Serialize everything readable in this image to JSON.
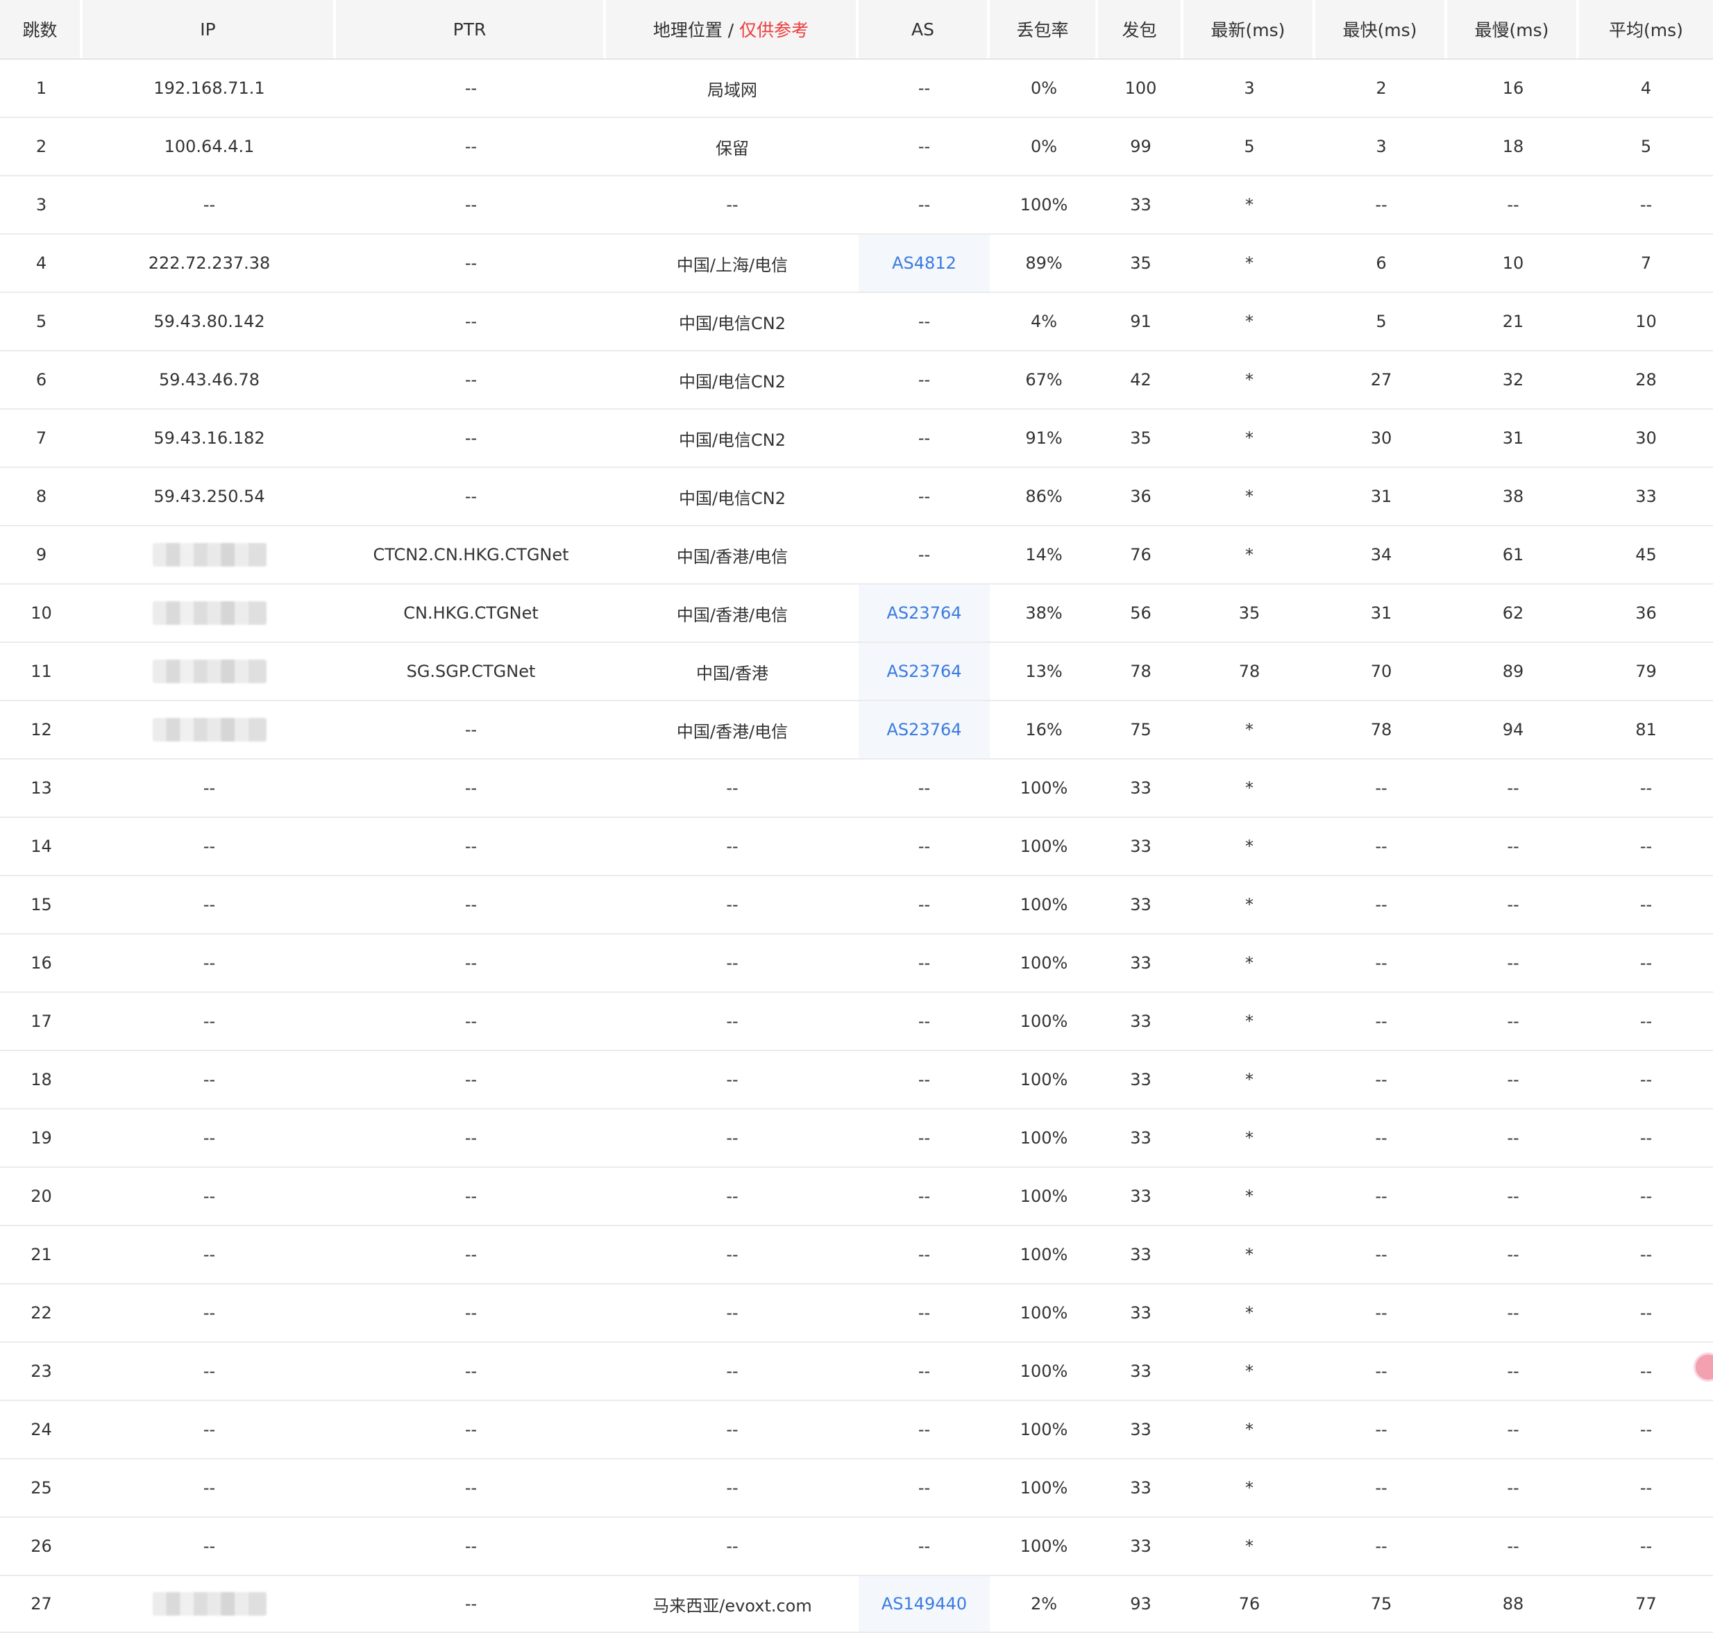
{
  "header": {
    "hop": "跳数",
    "ip": "IP",
    "ptr": "PTR",
    "geo": "地理位置 / ",
    "geo_ref": "仅供参考",
    "as": "AS",
    "loss": "丢包率",
    "sent": "发包",
    "last": "最新(ms)",
    "best": "最快(ms)",
    "worst": "最慢(ms)",
    "avg": "平均(ms)"
  },
  "rows": [
    {
      "hop": "1",
      "ip": "192.168.71.1",
      "ip_masked": false,
      "ptr": "--",
      "geo": "局域网",
      "as": "--",
      "loss": "0%",
      "sent": "100",
      "last": "3",
      "best": "2",
      "worst": "16",
      "avg": "4"
    },
    {
      "hop": "2",
      "ip": "100.64.4.1",
      "ip_masked": false,
      "ptr": "--",
      "geo": "保留",
      "as": "--",
      "loss": "0%",
      "sent": "99",
      "last": "5",
      "best": "3",
      "worst": "18",
      "avg": "5"
    },
    {
      "hop": "3",
      "ip": "--",
      "ip_masked": false,
      "ptr": "--",
      "geo": "--",
      "as": "--",
      "loss": "100%",
      "sent": "33",
      "last": "*",
      "best": "--",
      "worst": "--",
      "avg": "--"
    },
    {
      "hop": "4",
      "ip": "222.72.237.38",
      "ip_masked": false,
      "ptr": "--",
      "geo": "中国/上海/电信",
      "as": "AS4812",
      "loss": "89%",
      "sent": "35",
      "last": "*",
      "best": "6",
      "worst": "10",
      "avg": "7"
    },
    {
      "hop": "5",
      "ip": "59.43.80.142",
      "ip_masked": false,
      "ptr": "--",
      "geo": "中国/电信CN2",
      "as": "--",
      "loss": "4%",
      "sent": "91",
      "last": "*",
      "best": "5",
      "worst": "21",
      "avg": "10"
    },
    {
      "hop": "6",
      "ip": "59.43.46.78",
      "ip_masked": false,
      "ptr": "--",
      "geo": "中国/电信CN2",
      "as": "--",
      "loss": "67%",
      "sent": "42",
      "last": "*",
      "best": "27",
      "worst": "32",
      "avg": "28"
    },
    {
      "hop": "7",
      "ip": "59.43.16.182",
      "ip_masked": false,
      "ptr": "--",
      "geo": "中国/电信CN2",
      "as": "--",
      "loss": "91%",
      "sent": "35",
      "last": "*",
      "best": "30",
      "worst": "31",
      "avg": "30"
    },
    {
      "hop": "8",
      "ip": "59.43.250.54",
      "ip_masked": false,
      "ptr": "--",
      "geo": "中国/电信CN2",
      "as": "--",
      "loss": "86%",
      "sent": "36",
      "last": "*",
      "best": "31",
      "worst": "38",
      "avg": "33"
    },
    {
      "hop": "9",
      "ip": "",
      "ip_masked": true,
      "ptr": "CTCN2.CN.HKG.CTGNet",
      "geo": "中国/香港/电信",
      "as": "--",
      "loss": "14%",
      "sent": "76",
      "last": "*",
      "best": "34",
      "worst": "61",
      "avg": "45"
    },
    {
      "hop": "10",
      "ip": "",
      "ip_masked": true,
      "ptr": "CN.HKG.CTGNet",
      "geo": "中国/香港/电信",
      "as": "AS23764",
      "loss": "38%",
      "sent": "56",
      "last": "35",
      "best": "31",
      "worst": "62",
      "avg": "36"
    },
    {
      "hop": "11",
      "ip": "",
      "ip_masked": true,
      "ptr": "SG.SGP.CTGNet",
      "geo": "中国/香港",
      "as": "AS23764",
      "loss": "13%",
      "sent": "78",
      "last": "78",
      "best": "70",
      "worst": "89",
      "avg": "79"
    },
    {
      "hop": "12",
      "ip": "",
      "ip_masked": true,
      "ptr": "--",
      "geo": "中国/香港/电信",
      "as": "AS23764",
      "loss": "16%",
      "sent": "75",
      "last": "*",
      "best": "78",
      "worst": "94",
      "avg": "81"
    },
    {
      "hop": "13",
      "ip": "--",
      "ip_masked": false,
      "ptr": "--",
      "geo": "--",
      "as": "--",
      "loss": "100%",
      "sent": "33",
      "last": "*",
      "best": "--",
      "worst": "--",
      "avg": "--"
    },
    {
      "hop": "14",
      "ip": "--",
      "ip_masked": false,
      "ptr": "--",
      "geo": "--",
      "as": "--",
      "loss": "100%",
      "sent": "33",
      "last": "*",
      "best": "--",
      "worst": "--",
      "avg": "--"
    },
    {
      "hop": "15",
      "ip": "--",
      "ip_masked": false,
      "ptr": "--",
      "geo": "--",
      "as": "--",
      "loss": "100%",
      "sent": "33",
      "last": "*",
      "best": "--",
      "worst": "--",
      "avg": "--"
    },
    {
      "hop": "16",
      "ip": "--",
      "ip_masked": false,
      "ptr": "--",
      "geo": "--",
      "as": "--",
      "loss": "100%",
      "sent": "33",
      "last": "*",
      "best": "--",
      "worst": "--",
      "avg": "--"
    },
    {
      "hop": "17",
      "ip": "--",
      "ip_masked": false,
      "ptr": "--",
      "geo": "--",
      "as": "--",
      "loss": "100%",
      "sent": "33",
      "last": "*",
      "best": "--",
      "worst": "--",
      "avg": "--"
    },
    {
      "hop": "18",
      "ip": "--",
      "ip_masked": false,
      "ptr": "--",
      "geo": "--",
      "as": "--",
      "loss": "100%",
      "sent": "33",
      "last": "*",
      "best": "--",
      "worst": "--",
      "avg": "--"
    },
    {
      "hop": "19",
      "ip": "--",
      "ip_masked": false,
      "ptr": "--",
      "geo": "--",
      "as": "--",
      "loss": "100%",
      "sent": "33",
      "last": "*",
      "best": "--",
      "worst": "--",
      "avg": "--"
    },
    {
      "hop": "20",
      "ip": "--",
      "ip_masked": false,
      "ptr": "--",
      "geo": "--",
      "as": "--",
      "loss": "100%",
      "sent": "33",
      "last": "*",
      "best": "--",
      "worst": "--",
      "avg": "--"
    },
    {
      "hop": "21",
      "ip": "--",
      "ip_masked": false,
      "ptr": "--",
      "geo": "--",
      "as": "--",
      "loss": "100%",
      "sent": "33",
      "last": "*",
      "best": "--",
      "worst": "--",
      "avg": "--"
    },
    {
      "hop": "22",
      "ip": "--",
      "ip_masked": false,
      "ptr": "--",
      "geo": "--",
      "as": "--",
      "loss": "100%",
      "sent": "33",
      "last": "*",
      "best": "--",
      "worst": "--",
      "avg": "--"
    },
    {
      "hop": "23",
      "ip": "--",
      "ip_masked": false,
      "ptr": "--",
      "geo": "--",
      "as": "--",
      "loss": "100%",
      "sent": "33",
      "last": "*",
      "best": "--",
      "worst": "--",
      "avg": "--"
    },
    {
      "hop": "24",
      "ip": "--",
      "ip_masked": false,
      "ptr": "--",
      "geo": "--",
      "as": "--",
      "loss": "100%",
      "sent": "33",
      "last": "*",
      "best": "--",
      "worst": "--",
      "avg": "--"
    },
    {
      "hop": "25",
      "ip": "--",
      "ip_masked": false,
      "ptr": "--",
      "geo": "--",
      "as": "--",
      "loss": "100%",
      "sent": "33",
      "last": "*",
      "best": "--",
      "worst": "--",
      "avg": "--"
    },
    {
      "hop": "26",
      "ip": "--",
      "ip_masked": false,
      "ptr": "--",
      "geo": "--",
      "as": "--",
      "loss": "100%",
      "sent": "33",
      "last": "*",
      "best": "--",
      "worst": "--",
      "avg": "--"
    },
    {
      "hop": "27",
      "ip": "",
      "ip_masked": true,
      "ptr": "--",
      "geo": "马来西亚/evoxt.com",
      "as": "AS149440",
      "loss": "2%",
      "sent": "93",
      "last": "76",
      "best": "75",
      "worst": "88",
      "avg": "77"
    }
  ],
  "colors": {
    "as_link": "#3a7be0",
    "header_ref": "#ee3b3b",
    "header_bg": "#f5f5f5"
  }
}
